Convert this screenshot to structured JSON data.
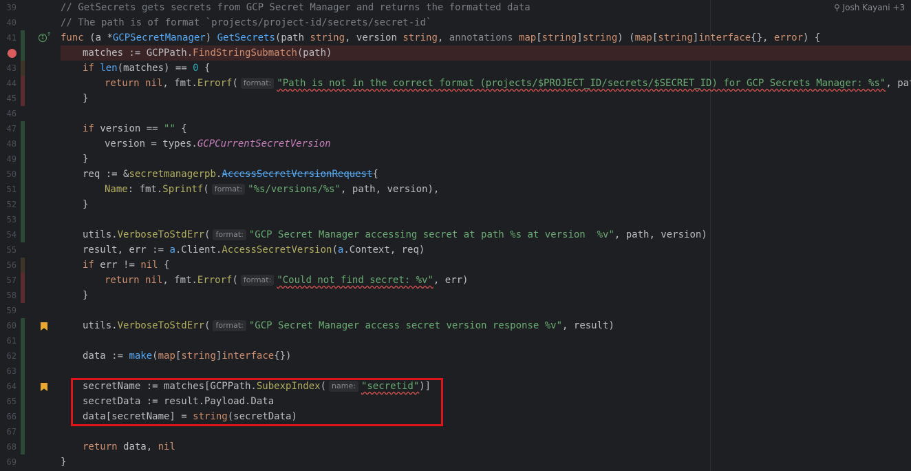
{
  "gutter": {
    "line_numbers": [
      "39",
      "40",
      "41",
      "42",
      "43",
      "44",
      "45",
      "46",
      "47",
      "48",
      "49",
      "50",
      "51",
      "52",
      "53",
      "54",
      "55",
      "56",
      "57",
      "58",
      "59",
      "60",
      "61",
      "62",
      "63",
      "64",
      "65",
      "66",
      "67",
      "68",
      "69"
    ]
  },
  "author_hint": "Josh Kayani +3",
  "hints": {
    "format": "format:",
    "name": "name:"
  },
  "code": {
    "l39": "// GetSecrets gets secrets from GCP Secret Manager and returns the formatted data",
    "l40": "// The path is of format `projects/project-id/secrets/secret-id`",
    "l41a": "func",
    "l41b": " (",
    "l41c": "a",
    "l41d": " *",
    "l41e": "GCPSecretManager",
    "l41f": ") ",
    "l41g": "GetSecrets",
    "l41h": "(path ",
    "l41i": "string",
    "l41j": ", version ",
    "l41k": "string",
    "l41l": ", ",
    "l41m": "annotations",
    "l41n": " ",
    "l41o": "map",
    "l41p": "[",
    "l41q": "string",
    "l41r": "]",
    "l41s": "string",
    "l41t": ") (",
    "l41u": "map",
    "l41v": "[",
    "l41w": "string",
    "l41x": "]",
    "l41y": "interface",
    "l41z": "{}, ",
    "l41aa": "error",
    "l41ab": ") {",
    "l42a": "matches := GCPPath.",
    "l42b": "FindStringSubmatch",
    "l42c": "(path)",
    "l43a": "if ",
    "l43b": "len",
    "l43c": "(matches) == ",
    "l43d": "0",
    "l43e": " {",
    "l44a": "return ",
    "l44b": "nil",
    "l44c": ", fmt.",
    "l44d": "Errorf",
    "l44e": "(",
    "l44f": "\"Path is not in the correct format (projects/$PROJECT_ID/secrets/$SECRET_ID) for GCP Secrets Manager: %s\"",
    "l44g": ", path)",
    "l45": "}",
    "l47a": "if ",
    "l47b": "version == ",
    "l47c": "\"\"",
    "l47d": " {",
    "l48a": "version = types.",
    "l48b": "GCPCurrentSecretVersion",
    "l49": "}",
    "l50a": "req := &",
    "l50b": "secretmanagerpb",
    "l50c": ".",
    "l50d": "AccessSecretVersionRequest",
    "l50e": "{",
    "l51a": "Name",
    "l51b": ": fmt.",
    "l51c": "Sprintf",
    "l51d": "(",
    "l51e": "\"%s/versions/%s\"",
    "l51f": ", path, version),",
    "l52": "}",
    "l54a": "utils.",
    "l54b": "VerboseToStdErr",
    "l54c": "(",
    "l54d": "\"GCP Secret Manager accessing secret at path %s at version  %v\"",
    "l54e": ", path, version)",
    "l55a": "result, err := ",
    "l55b": "a",
    "l55c": ".Client.",
    "l55d": "AccessSecretVersion",
    "l55e": "(",
    "l55f": "a",
    "l55g": ".Context, req)",
    "l56a": "if ",
    "l56b": "err != ",
    "l56c": "nil",
    "l56d": " {",
    "l57a": "return ",
    "l57b": "nil",
    "l57c": ", fmt.",
    "l57d": "Errorf",
    "l57e": "(",
    "l57f": "\"Could not find secret: %v\"",
    "l57g": ", err)",
    "l58": "}",
    "l60a": "utils.",
    "l60b": "VerboseToStdErr",
    "l60c": "(",
    "l60d": "\"GCP Secret Manager access secret version response %v\"",
    "l60e": ", result)",
    "l62a": "data := ",
    "l62b": "make",
    "l62c": "(",
    "l62d": "map",
    "l62e": "[",
    "l62f": "string",
    "l62g": "]",
    "l62h": "interface",
    "l62i": "{})",
    "l64a": "secretName := matches[GCPPath.",
    "l64b": "SubexpIndex",
    "l64c": "(",
    "l64d": "\"secretid\"",
    "l64e": ")]",
    "l65": "secretData := result.Payload.Data",
    "l66a": "data[secretName] = ",
    "l66b": "string",
    "l66c": "(secretData)",
    "l68a": "return ",
    "l68b": "data, ",
    "l68c": "nil",
    "l69": "}"
  }
}
